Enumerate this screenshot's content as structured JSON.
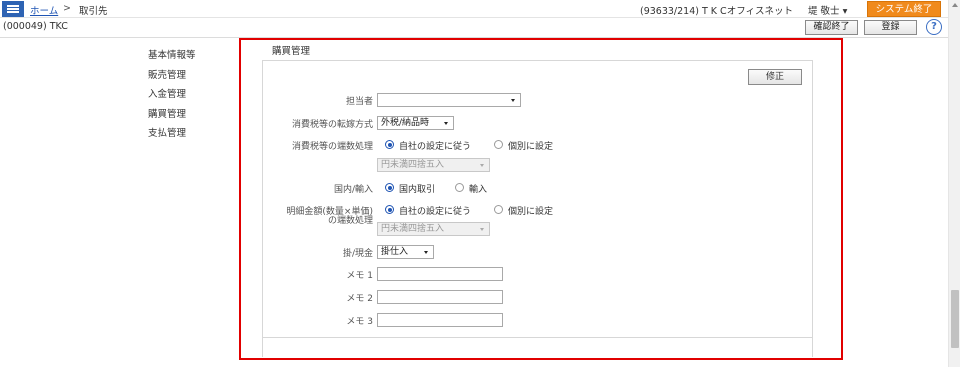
{
  "header": {
    "home_link": "ホーム",
    "separator": ">",
    "current": "取引先",
    "user_info": "(93633/214) T K Cオフィスネット",
    "user_name": "堤  敬士",
    "exit_button": "システム終了"
  },
  "subheader": {
    "code": "(000049) TKC",
    "confirm_button": "確認終了",
    "register_button": "登録",
    "help": "?"
  },
  "sidebar": {
    "items": [
      "基本情報等",
      "販売管理",
      "入金管理",
      "購買管理",
      "支払管理"
    ]
  },
  "panel": {
    "title": "購買管理",
    "edit_button": "修正",
    "fields": {
      "tantousha": {
        "label": "担当者",
        "value": ""
      },
      "tenka": {
        "label": "消費税等の転嫁方式",
        "value": "外税/納品時"
      },
      "hasu": {
        "label": "消費税等の端数処理",
        "option_company": "自社の設定に従う",
        "option_individual": "個別に設定",
        "select_value": "円未満四捨五入"
      },
      "kokunai": {
        "label": "国内/輸入",
        "option_domestic": "国内取引",
        "option_import": "輸入"
      },
      "meisai": {
        "label_line1": "明細金額(数量×単価)",
        "label_line2": "の端数処理",
        "option_company": "自社の設定に従う",
        "option_individual": "個別に設定",
        "select_value": "円未満四捨五入"
      },
      "kake": {
        "label": "掛/現金",
        "value": "掛仕入"
      },
      "memo1": {
        "label": "メモ 1",
        "value": ""
      },
      "memo2": {
        "label": "メモ 2",
        "value": ""
      },
      "memo3": {
        "label": "メモ 3",
        "value": ""
      }
    }
  },
  "colors": {
    "accent_blue": "#1f54b3",
    "exit_orange": "#f08a1c",
    "highlight_red": "#e10000"
  }
}
